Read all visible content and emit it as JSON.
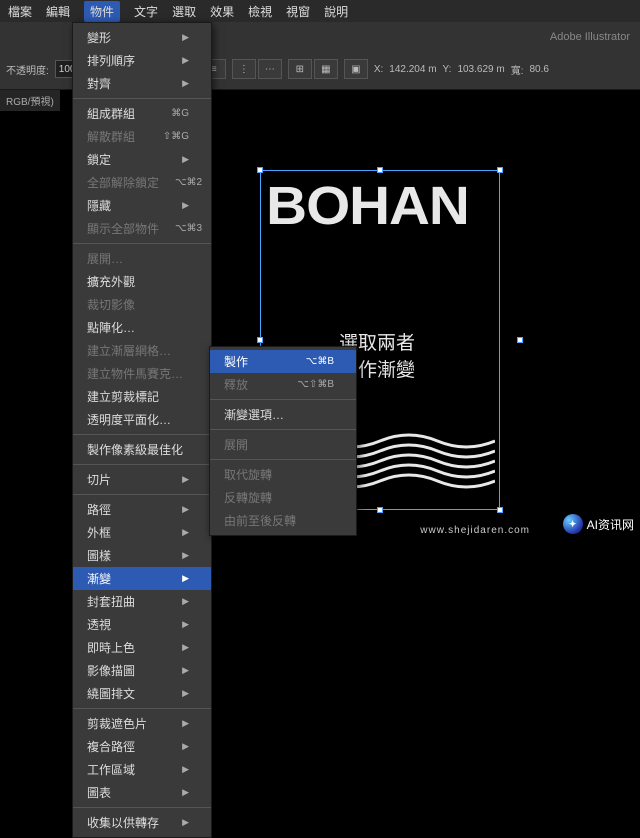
{
  "menubar": [
    "檔案",
    "編輯",
    "物件",
    "文字",
    "選取",
    "效果",
    "檢視",
    "視窗",
    "說明"
  ],
  "activeMenu": 2,
  "appname": "Adobe Illustrator",
  "toolbar": {
    "opacityLabel": "不透明度:",
    "opacityValue": "100",
    "xLabel": "X:",
    "xValue": "142.204 m",
    "yLabel": "Y:",
    "yValue": "103.629 m",
    "wLabel": "寬:",
    "wValue": "80.6"
  },
  "docTab": "RGB/預視)",
  "artText": "BOHAN",
  "annotation": {
    "l1": "選取兩者",
    "l2": "製作漸變"
  },
  "menu1": [
    {
      "t": "變形",
      "sub": true
    },
    {
      "t": "排列順序",
      "sub": true
    },
    {
      "t": "對齊",
      "sub": true
    },
    {
      "sep": true
    },
    {
      "t": "組成群組",
      "sc": "⌘G"
    },
    {
      "t": "解散群組",
      "sc": "⇧⌘G",
      "dis": true
    },
    {
      "t": "鎖定",
      "sub": true
    },
    {
      "t": "全部解除鎖定",
      "sc": "⌥⌘2",
      "dis": true
    },
    {
      "t": "隱藏",
      "sub": true
    },
    {
      "t": "顯示全部物件",
      "sc": "⌥⌘3",
      "dis": true
    },
    {
      "sep": true
    },
    {
      "t": "展開…",
      "dis": true
    },
    {
      "t": "擴充外觀"
    },
    {
      "t": "裁切影像",
      "dis": true
    },
    {
      "t": "點陣化…"
    },
    {
      "t": "建立漸層網格…",
      "dis": true
    },
    {
      "t": "建立物件馬賽克…",
      "dis": true
    },
    {
      "t": "建立剪裁標記"
    },
    {
      "t": "透明度平面化…"
    },
    {
      "sep": true
    },
    {
      "t": "製作像素級最佳化"
    },
    {
      "sep": true
    },
    {
      "t": "切片",
      "sub": true
    },
    {
      "sep": true
    },
    {
      "t": "路徑",
      "sub": true
    },
    {
      "t": "外框",
      "sub": true
    },
    {
      "t": "圖樣",
      "sub": true
    },
    {
      "t": "漸變",
      "sub": true,
      "hl": true
    },
    {
      "t": "封套扭曲",
      "sub": true
    },
    {
      "t": "透視",
      "sub": true
    },
    {
      "t": "即時上色",
      "sub": true
    },
    {
      "t": "影像描圖",
      "sub": true
    },
    {
      "t": "繞圖排文",
      "sub": true
    },
    {
      "sep": true
    },
    {
      "t": "剪裁遮色片",
      "sub": true
    },
    {
      "t": "複合路徑",
      "sub": true
    },
    {
      "t": "工作區域",
      "sub": true
    },
    {
      "t": "圖表",
      "sub": true
    },
    {
      "sep": true
    },
    {
      "t": "收集以供轉存",
      "sub": true
    }
  ],
  "menu2": [
    {
      "t": "製作",
      "sc": "⌥⌘B",
      "hl": true
    },
    {
      "t": "釋放",
      "sc": "⌥⇧⌘B",
      "dis": true
    },
    {
      "sep": true
    },
    {
      "t": "漸變選項…"
    },
    {
      "sep": true
    },
    {
      "t": "展開",
      "dis": true
    },
    {
      "sep": true
    },
    {
      "t": "取代旋轉",
      "dis": true
    },
    {
      "t": "反轉旋轉",
      "dis": true
    },
    {
      "t": "由前至後反轉",
      "dis": true
    }
  ],
  "watermark": {
    "brand": "AI资讯网",
    "url": "www.shejidaren.com"
  }
}
